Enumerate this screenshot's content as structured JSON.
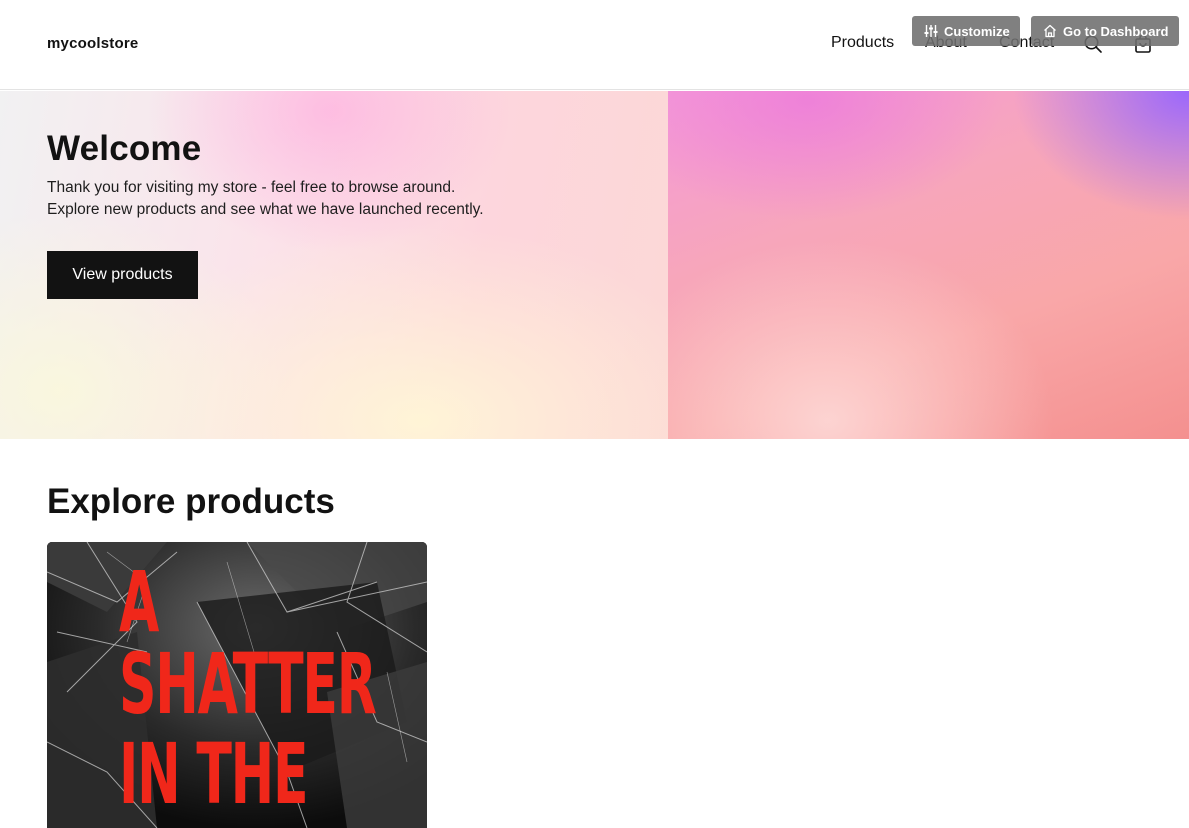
{
  "header": {
    "logo": "mycoolstore",
    "nav": [
      "Products",
      "About",
      "Contact"
    ],
    "icons": [
      "search-icon",
      "cart-icon"
    ]
  },
  "admin": {
    "customize_label": "Customize",
    "dashboard_label": "Go to Dashboard"
  },
  "hero": {
    "title": "Welcome",
    "line1": "Thank you for visiting my store - feel free to browse around.",
    "line2": "Explore new products and see what we have launched recently.",
    "button_label": "View products"
  },
  "products": {
    "title": "Explore products",
    "items": [
      {
        "cover_lines": [
          "A",
          "SHATTER",
          "IN THE"
        ]
      }
    ]
  },
  "colors": {
    "text": "#121212",
    "button_bg": "#121212",
    "cover_text": "#f0271a",
    "admin_btn_bg": "#6e6e6e"
  }
}
